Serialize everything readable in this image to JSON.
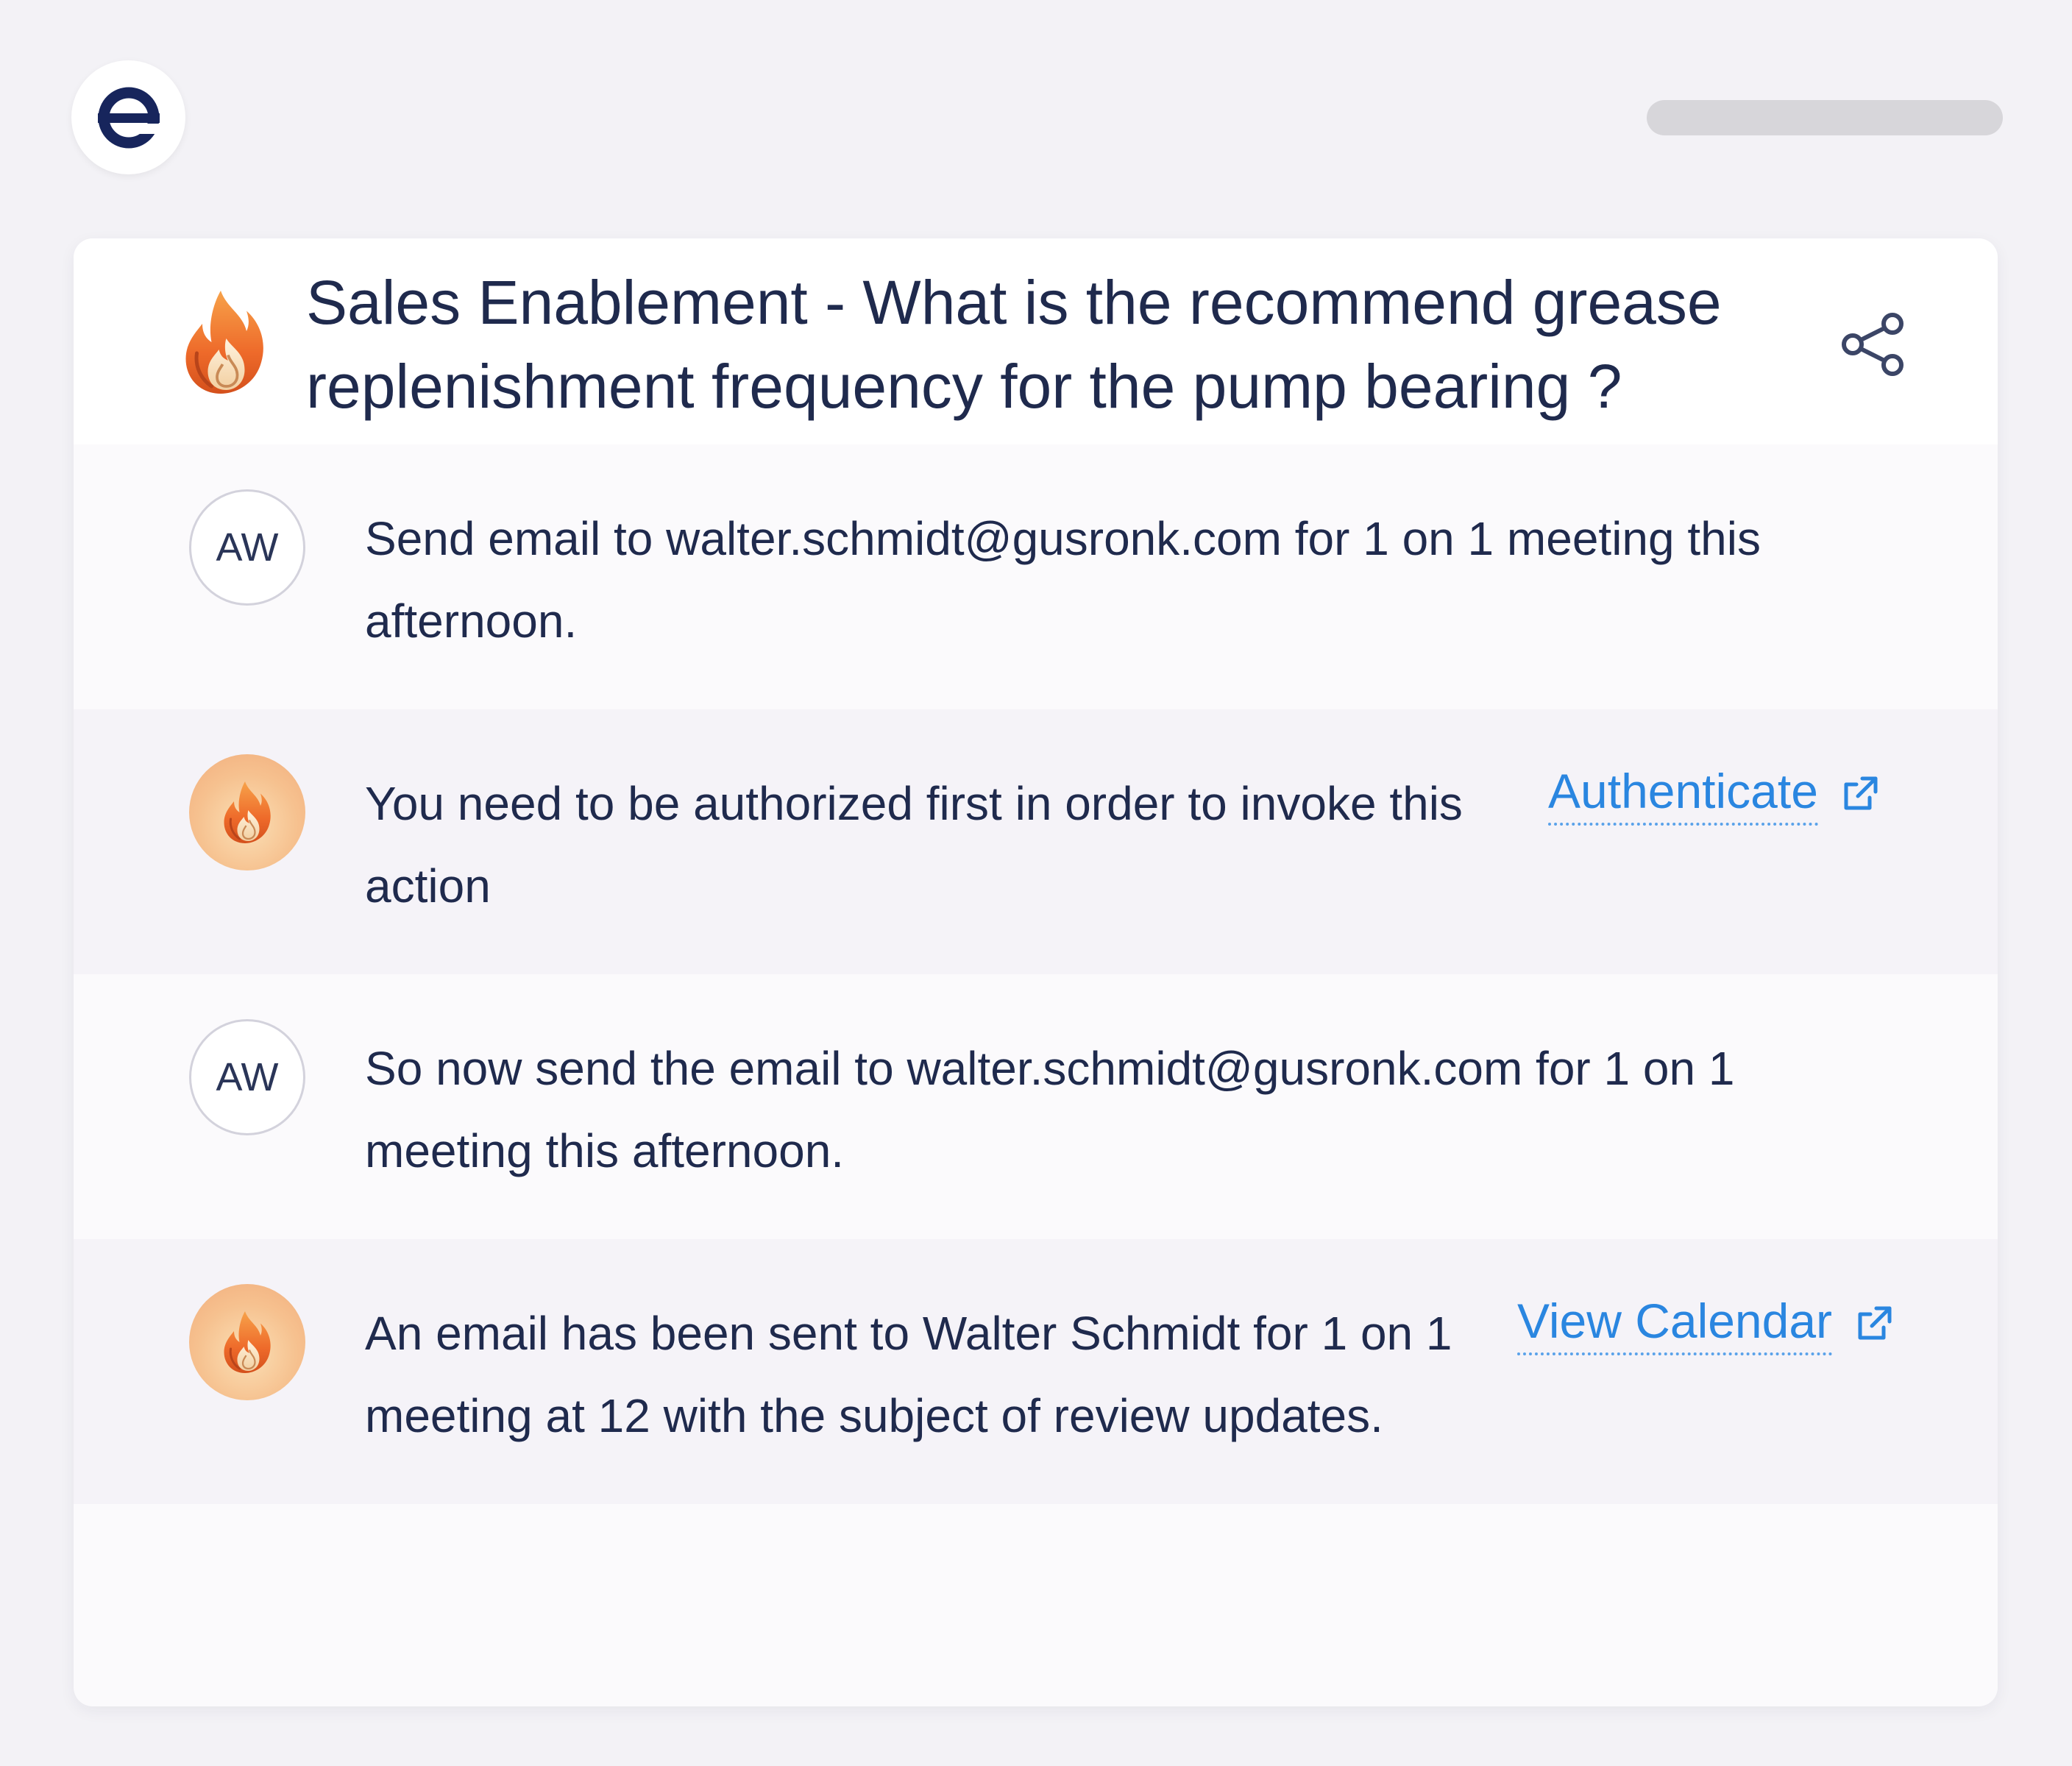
{
  "logo": {
    "icon": "brand-e-logo",
    "color": "#17255c"
  },
  "header": {
    "title": "Sales Enablement - What is the recommend grease replenishment frequency for the pump bearing ?",
    "icon": "flame-icon",
    "share_icon": "share-icon"
  },
  "messages": [
    {
      "role": "user",
      "avatar": "AW",
      "text": "Send email to walter.schmidt@gusronk.com for 1 on 1 meeting this afternoon."
    },
    {
      "role": "assistant",
      "avatar_icon": "flame-icon",
      "text": "You need to be authorized first in order to invoke this action",
      "action": {
        "label": "Authenticate",
        "icon": "external-link-icon"
      }
    },
    {
      "role": "user",
      "avatar": "AW",
      "text": "So now send the email to walter.schmidt@gusronk.com for 1 on 1 meeting this afternoon."
    },
    {
      "role": "assistant",
      "avatar_icon": "flame-icon",
      "text": "An email has been sent to Walter Schmidt for 1 on 1 meeting at 12 with the subject of review updates.",
      "action": {
        "label": "View Calendar",
        "icon": "external-link-icon"
      }
    }
  ],
  "colors": {
    "accent": "#2a86e0",
    "text": "#1f2a4d",
    "bot_row": "#f5f3f8",
    "page_bg": "#f3f2f6"
  }
}
